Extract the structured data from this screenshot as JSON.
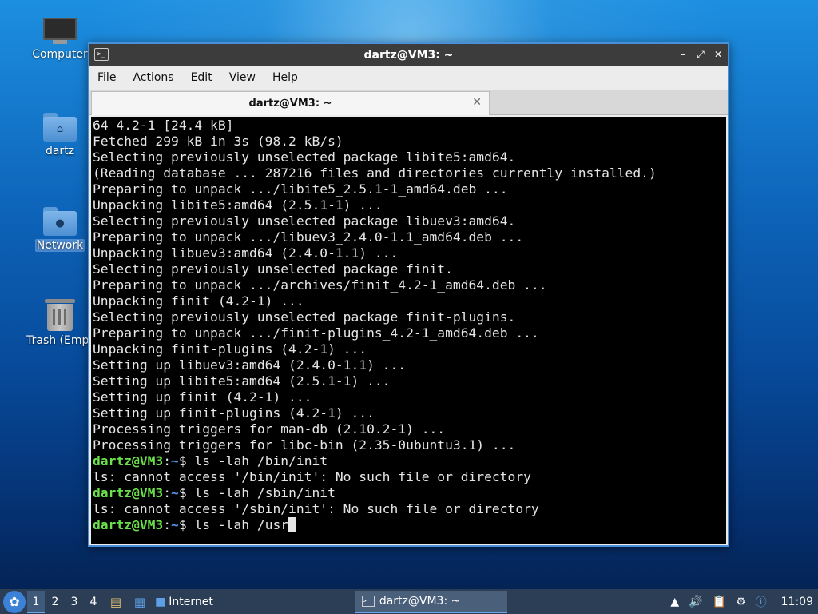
{
  "desktop": {
    "icons": [
      {
        "label": "Computer",
        "icon": "computer-icon"
      },
      {
        "label": "dartz",
        "icon": "home-folder-icon"
      },
      {
        "label": "Network",
        "icon": "network-folder-icon"
      },
      {
        "label": "Trash (Empt",
        "icon": "trash-icon"
      }
    ]
  },
  "window": {
    "title": "dartz@VM3: ~",
    "menu": [
      "File",
      "Actions",
      "Edit",
      "View",
      "Help"
    ],
    "tab_title": "dartz@VM3: ~",
    "terminal": {
      "lines": [
        "64 4.2-1 [24.4 kB]",
        "Fetched 299 kB in 3s (98.2 kB/s)",
        "Selecting previously unselected package libite5:amd64.",
        "(Reading database ... 287216 files and directories currently installed.)",
        "Preparing to unpack .../libite5_2.5.1-1_amd64.deb ...",
        "Unpacking libite5:amd64 (2.5.1-1) ...",
        "Selecting previously unselected package libuev3:amd64.",
        "Preparing to unpack .../libuev3_2.4.0-1.1_amd64.deb ...",
        "Unpacking libuev3:amd64 (2.4.0-1.1) ...",
        "Selecting previously unselected package finit.",
        "Preparing to unpack .../archives/finit_4.2-1_amd64.deb ...",
        "Unpacking finit (4.2-1) ...",
        "Selecting previously unselected package finit-plugins.",
        "Preparing to unpack .../finit-plugins_4.2-1_amd64.deb ...",
        "Unpacking finit-plugins (4.2-1) ...",
        "Setting up libuev3:amd64 (2.4.0-1.1) ...",
        "Setting up libite5:amd64 (2.5.1-1) ...",
        "Setting up finit (4.2-1) ...",
        "Setting up finit-plugins (4.2-1) ...",
        "Processing triggers for man-db (2.10.2-1) ...",
        "Processing triggers for libc-bin (2.35-0ubuntu3.1) ..."
      ],
      "prompt_user": "dartz@VM3",
      "prompt_sep": ":",
      "prompt_path": "~",
      "prompt_dollar": "$ ",
      "cmd1": "ls -lah /bin/init",
      "err1": "ls: cannot access '/bin/init': No such file or directory",
      "cmd2": "ls -lah /sbin/init",
      "err2": "ls: cannot access '/sbin/init': No such file or directory",
      "cmd3": "ls -lah /usr"
    }
  },
  "taskbar": {
    "workspaces": [
      "1",
      "2",
      "3",
      "4"
    ],
    "launcher_label": "Internet",
    "task_label": "dartz@VM3: ~",
    "clock": "11:09"
  }
}
